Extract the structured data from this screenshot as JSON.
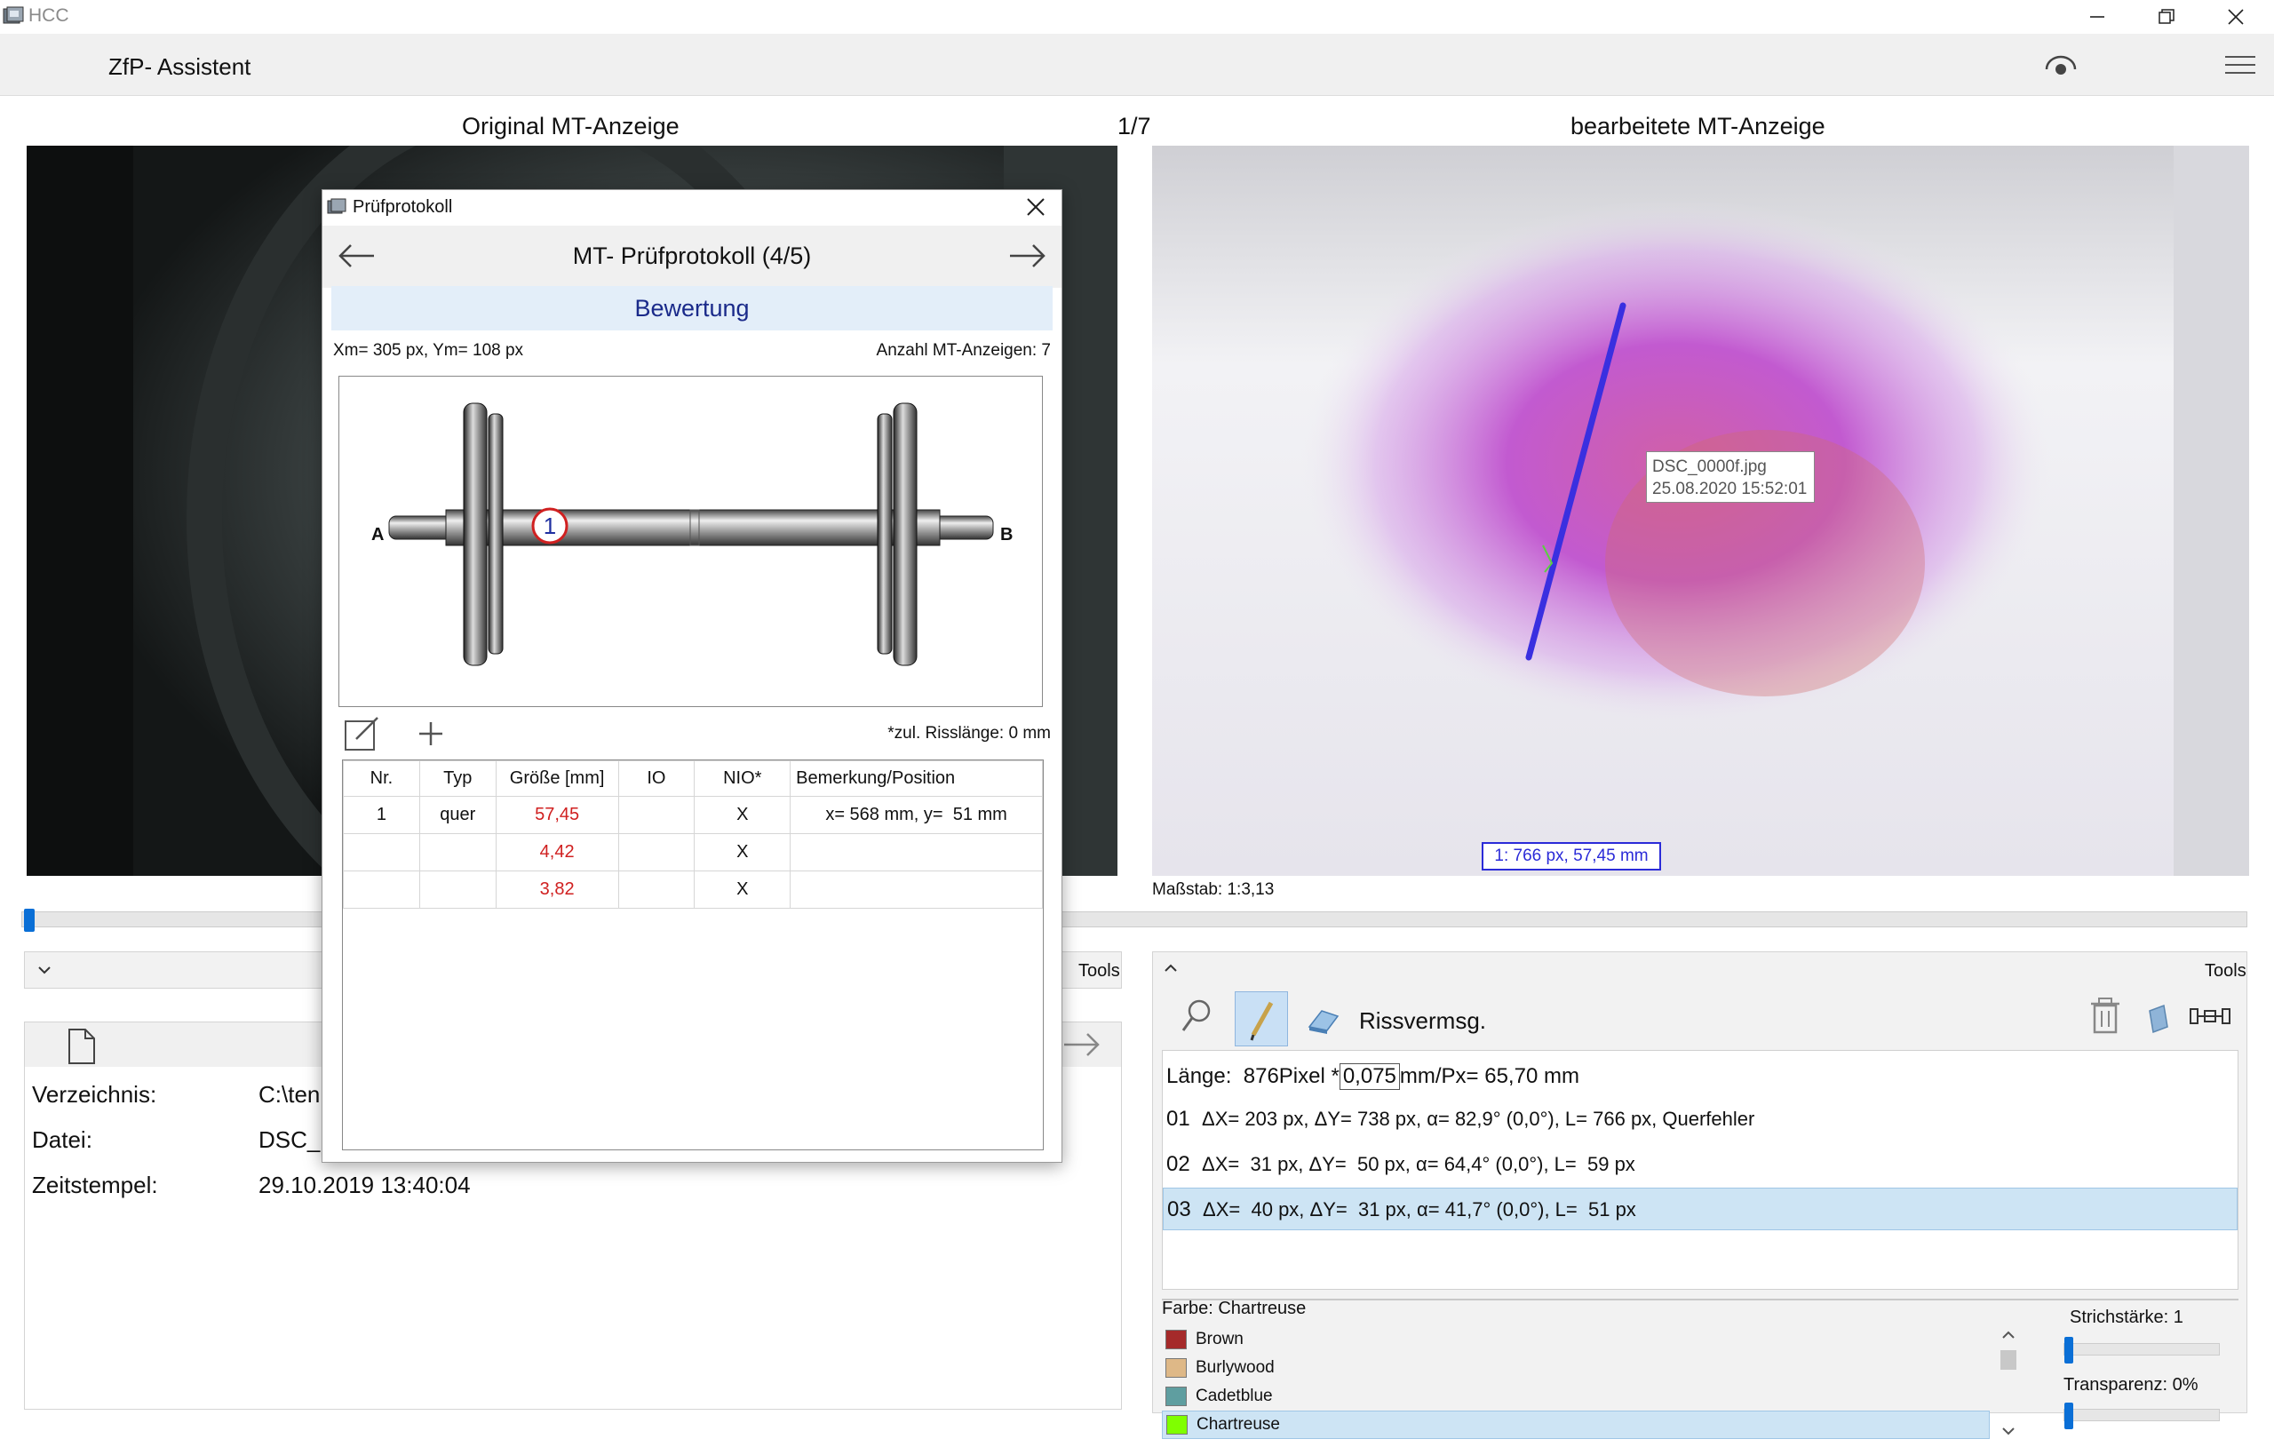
{
  "window": {
    "title": "HCC"
  },
  "toolbar": {
    "title": "ZfP- Assistent"
  },
  "captions": {
    "left": "Original MT-Anzeige",
    "counter": "1/7",
    "right": "bearbeitete MT-Anzeige"
  },
  "right_image": {
    "tooltip_file": "DSC_0000f.jpg",
    "tooltip_date": "25.08.2020 15:52:01",
    "measure_label": "1:  766 px, 57,45 mm",
    "scale": "Maßstab: 1:3,13"
  },
  "dialog": {
    "title": "Prüfprotokoll",
    "heading": "MT- Prüfprotokoll (4/5)",
    "section": "Bewertung",
    "coords": "Xm= 305 px, Ym= 108 px",
    "count": "Anzahl MT-Anzeigen: 7",
    "axle_label_a": "A",
    "axle_label_b": "B",
    "marker": "1",
    "allowed_crack": "*zul. Risslänge: 0 mm",
    "table": {
      "headers": [
        "Nr.",
        "Typ",
        "Größe [mm]",
        "IO",
        "NIO*",
        "Bemerkung/Position"
      ],
      "rows": [
        [
          "1",
          "quer",
          "57,45",
          "",
          "X",
          "x= 568 mm, y=  51 mm"
        ],
        [
          "",
          "",
          "4,42",
          "",
          "X",
          ""
        ],
        [
          "",
          "",
          "3,82",
          "",
          "X",
          ""
        ]
      ]
    }
  },
  "left_panel": {
    "tools_label": "Tools",
    "fields": [
      {
        "label": "Verzeichnis:",
        "value": "C:\\ten"
      },
      {
        "label": "Datei:",
        "value": "DSC_("
      },
      {
        "label": "Zeitstempel:",
        "value": "29.10.2019 13:40:04"
      }
    ]
  },
  "right_panel": {
    "tools_label": "Tools",
    "tool_name": "Rissvermsg.",
    "laenge_prefix": "Länge:",
    "laenge_pixel": "876",
    "laenge_pixel_unit": "Pixel *",
    "laenge_factor": "0,075",
    "laenge_result": "mm/Px= 65,70 mm",
    "measurements": [
      {
        "id": "01",
        "text": "ΔX= 203 px, ΔY= 738 px, α= 82,9° (0,0°), L= 766 px, Querfehler"
      },
      {
        "id": "02",
        "text": "ΔX=  31 px, ΔY=  50 px, α= 64,4° (0,0°), L=  59 px"
      },
      {
        "id": "03",
        "text": "ΔX=  40 px, ΔY=  31 px, α= 41,7° (0,0°), L=  51 px"
      }
    ],
    "farbe_label": "Farbe: Chartreuse",
    "colors": [
      {
        "name": "Brown",
        "hex": "#a52a2a"
      },
      {
        "name": "Burlywood",
        "hex": "#deb887"
      },
      {
        "name": "Cadetblue",
        "hex": "#5f9ea0"
      },
      {
        "name": "Chartreuse",
        "hex": "#7fff00"
      }
    ],
    "strichstaerke": "Strichstärke: 1",
    "transparenz": "Transparenz: 0%"
  }
}
